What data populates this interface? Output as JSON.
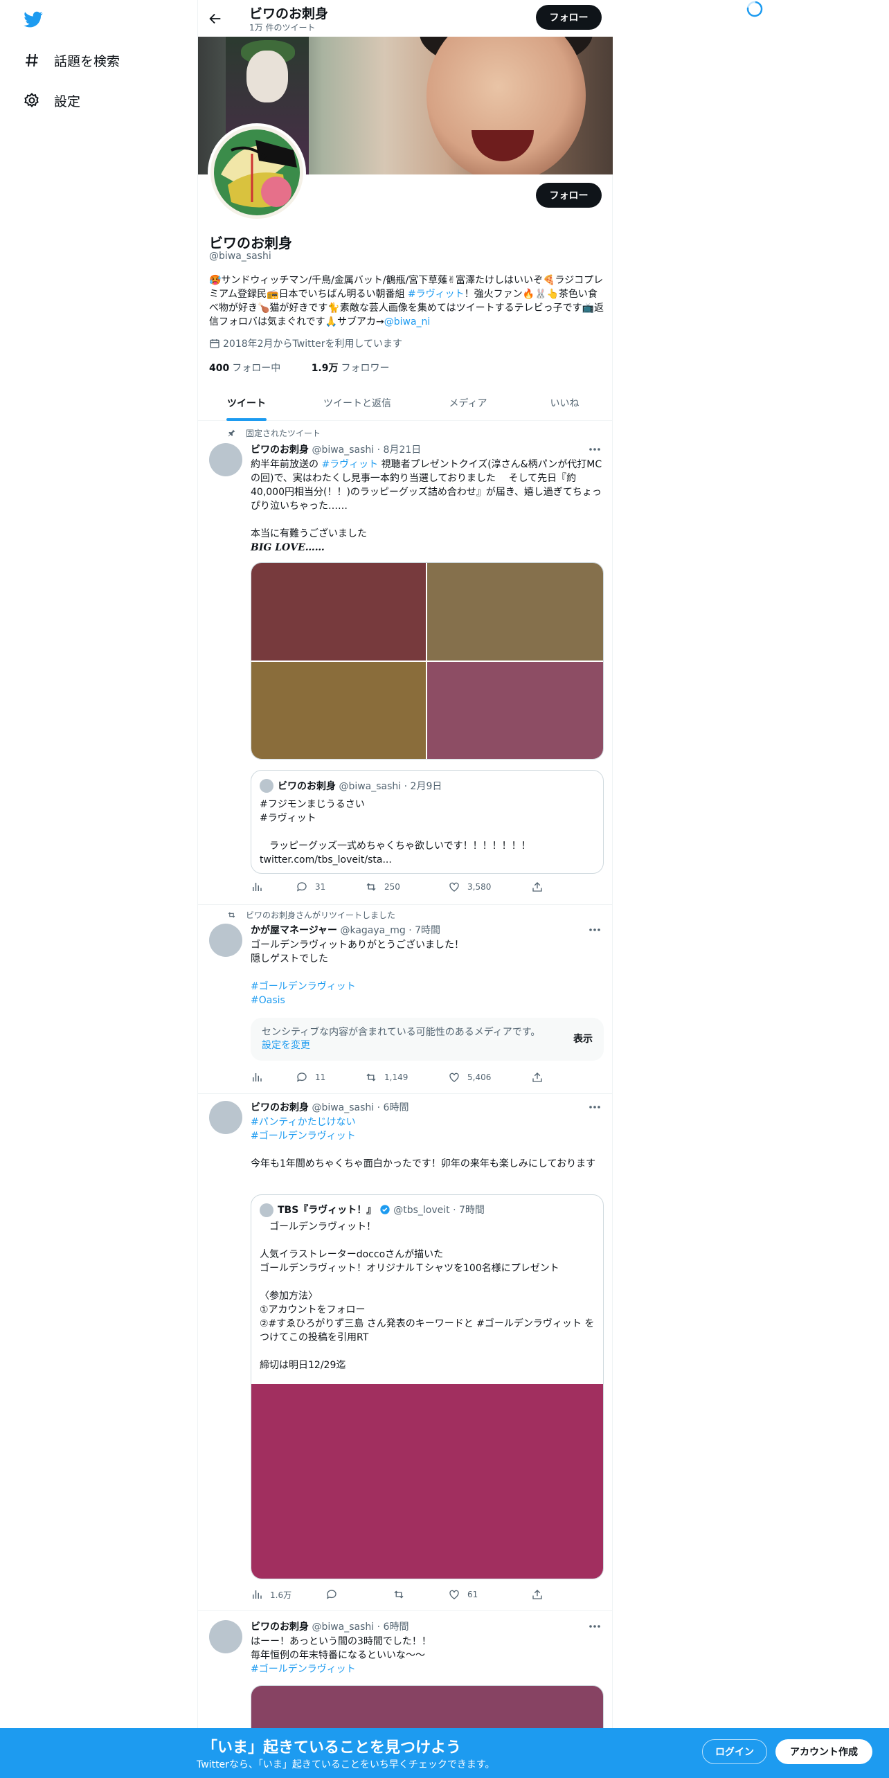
{
  "nav": {
    "explore_label": "話題を検索",
    "settings_label": "設定"
  },
  "header": {
    "name": "ビワのお刺身",
    "tweet_count": "1万 件のツイート",
    "follow_label": "フォロー"
  },
  "profile": {
    "follow_label": "フォロー",
    "name": "ビワのお刺身",
    "handle": "@biwa_sashi",
    "bio_1": "🥵サンドウィッチマン/千鳥/金属バット/鶴瓶/宮下草薙✌富澤たけしはいいぞ🍕ラジコプレミアム登録民📻日本でいちばん明るい朝番組 ",
    "bio_tag": "#ラヴィット",
    "bio_2": "！強火ファン🔥🐰👆茶色い食べ物が好き🍗猫が好きです🐈素敵な芸人画像を集めてはツイートするテレビっ子です📺返信フォロバは気まぐれです🙏サブアカ→",
    "bio_link": "@biwa_ni",
    "joined": "2018年2月からTwitterを利用しています",
    "following_count": "400",
    "following_label": "フォロー中",
    "followers_count": "1.9万",
    "followers_label": "フォロワー"
  },
  "tabs": [
    "ツイート",
    "ツイートと返信",
    "メディア",
    "いいね"
  ],
  "tweet1": {
    "pinned_label": "固定されたツイート",
    "name": "ビワのお刺身",
    "meta": "@biwa_sashi · 8月21日",
    "text_a": "約半年前放送の ",
    "text_tag": "#ラヴィット",
    "text_b": " 視聴者プレゼントクイズ(淳さん&柄パンが代打MCの回)で、実はわたくし見事一本釣り当選しておりました　 そして先日『約40,000円相当分(！！)のラッピーグッズ詰め合わせ』が届き、嬉し過ぎてちょっぴり泣いちゃった……\n\n本当に有難うございました",
    "text_c": "𝑩𝑰𝑮 𝑳𝑶𝑽𝑬……",
    "media_colors": [
      "#773a3d",
      "#85704c",
      "#8a6d3b",
      "#8d4d64"
    ],
    "quote": {
      "name": "ビワのお刺身",
      "meta": "@biwa_sashi · 2月9日",
      "text": "#フジモンまじうるさい\n#ラヴィット\n\n　ラッピーグッズ一式めちゃくちゃ欲しいです！！！！！！！",
      "link": "twitter.com/tbs_loveit/sta..."
    },
    "replies": "31",
    "retweets": "250",
    "likes": "3,580"
  },
  "tweet2": {
    "retweet_label": "ビワのお刺身さんがリツイートしました",
    "name": "かが屋マネージャー",
    "meta": "@kagaya_mg · 7時間",
    "text": "ゴールデンラヴィットありがとうございました！\n隠しゲストでした",
    "tag1": "#ゴールデンラヴィット",
    "tag2": "#Oasis",
    "sensitive_text": "センシティブな内容が含まれている可能性のあるメディアです。",
    "sensitive_link": "設定を変更",
    "sensitive_button": "表示",
    "replies": "11",
    "retweets": "1,149",
    "likes": "5,406"
  },
  "tweet3": {
    "name": "ビワのお刺身",
    "meta": "@biwa_sashi · 6時間",
    "tag1": "#パンティかたじけない",
    "tag2": "#ゴールデンラヴィット",
    "text": "今年も1年間めちゃくちゃ面白かったです！卯年の来年も楽しみにしております",
    "quote": {
      "name": "TBS『ラヴィット！』",
      "meta": "@tbs_loveit · 7時間",
      "text": "　ゴールデンラヴィット！\n\n人気イラストレーターdoccoさんが描いた\nゴールデンラヴィット！オリジナルＴシャツを100名様にプレゼント\n\n〈参加方法〉\n①アカウントをフォロー\n②#すゑひろがりず三島 さん発表のキーワードと #ゴールデンラヴィット をつけてこの投稿を引用RT\n\n締切は明日12/29迄",
      "media_color": "#a12f5f"
    },
    "views": "1.6万",
    "likes": "61"
  },
  "tweet4": {
    "name": "ビワのお刺身",
    "meta": "@biwa_sashi · 6時間",
    "text": "はーー！あっという間の3時間でした！！\n毎年恒例の年末特番になるといいな～～",
    "tag": "#ゴールデンラヴィット",
    "media_color": "#874363"
  },
  "bottom": {
    "title": "「いま」起きていることを見つけよう",
    "subtitle": "Twitterなら、「いま」起きていることをいち早くチェックできます。",
    "login": "ログイン",
    "signup": "アカウント作成"
  },
  "colors": {
    "accent": "#1d9bf0",
    "text": "#0f1419",
    "secondary": "#536471"
  }
}
